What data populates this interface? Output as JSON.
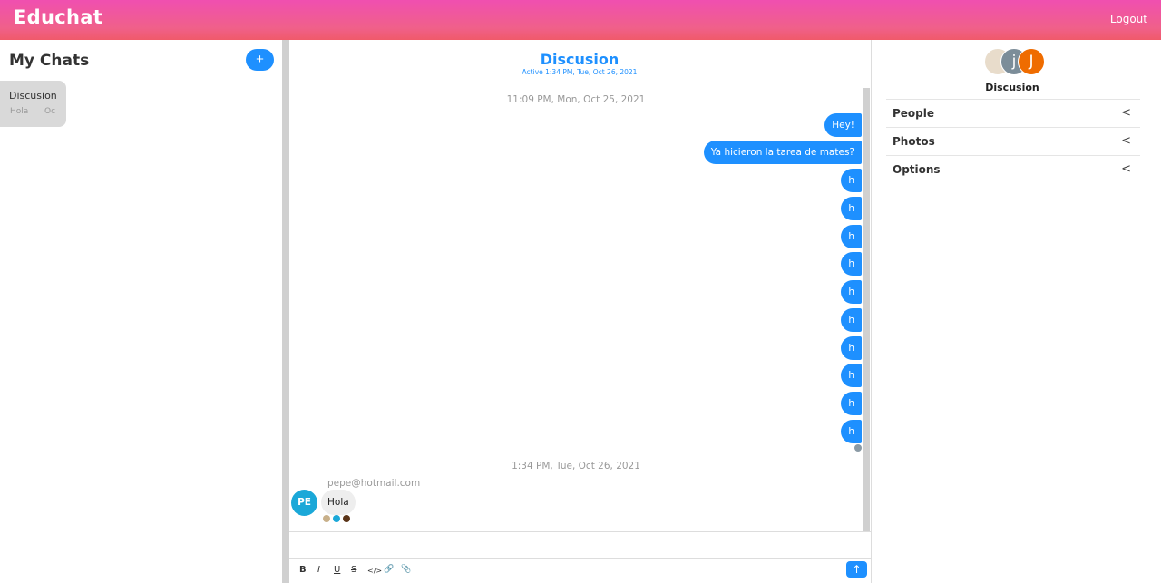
{
  "app": {
    "brand": "Educhat",
    "logout_label": "Logout"
  },
  "sidebar": {
    "title": "My Chats",
    "new_chat_label": "+",
    "chats": [
      {
        "title": "Discusion",
        "preview": "Hola",
        "time": "Oc"
      }
    ]
  },
  "chat": {
    "title": "Discusion",
    "subtitle": "Active 1:34 PM, Tue, Oct 26, 2021",
    "timestamps": [
      "11:09 PM, Mon, Oct 25, 2021",
      "1:34 PM, Tue, Oct 26, 2021"
    ],
    "my_messages": [
      "Hey!",
      "Ya hicieron la tarea de mates?",
      "h",
      "h",
      "h",
      "h",
      "h",
      "h",
      "h",
      "h",
      "h",
      "h"
    ],
    "incoming": {
      "sender": "pepe@hotmail.com",
      "avatar_initials": "PE",
      "text": "Hola"
    },
    "read_receipt_colors": [
      "#c8b08a",
      "#1ba8d8",
      "#5a3418"
    ],
    "toolbar": {
      "bold": "B",
      "italic": "I",
      "underline": "U",
      "strike": "S",
      "code": "</>",
      "link": "🔗",
      "attach": "📎",
      "send": "↑"
    }
  },
  "details": {
    "title": "Discusion",
    "avatars": [
      {
        "kind": "photo",
        "color": "#e8dccb"
      },
      {
        "letter": "j",
        "color": "#7c8d99"
      },
      {
        "letter": "J",
        "color": "#ef6c00"
      }
    ],
    "sections": [
      {
        "label": "People",
        "chevron": "<"
      },
      {
        "label": "Photos",
        "chevron": "<"
      },
      {
        "label": "Options",
        "chevron": "<"
      }
    ]
  },
  "colors": {
    "accent": "#1e90ff",
    "topbar": "#f04f9b"
  }
}
